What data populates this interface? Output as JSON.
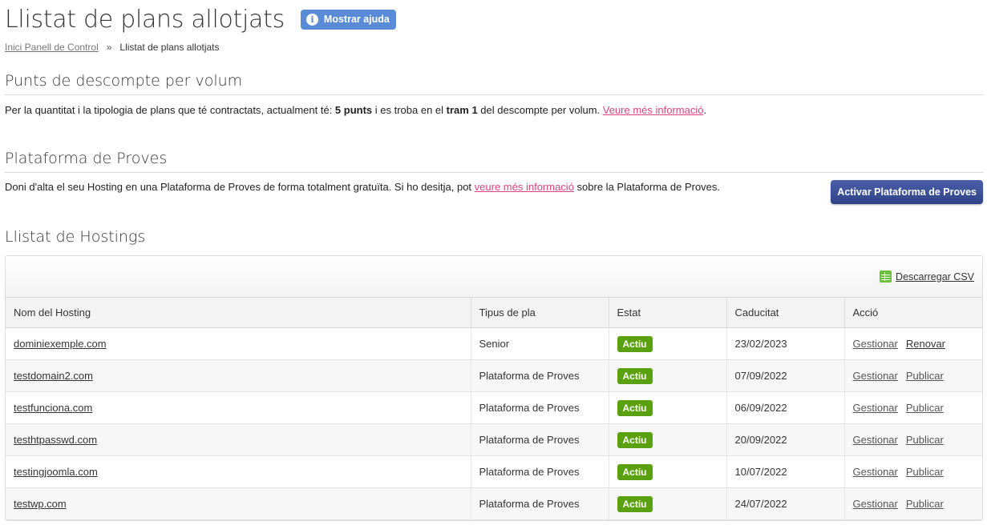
{
  "header": {
    "title": "Llistat de plans allotjats",
    "help_label": "Mostrar ajuda"
  },
  "breadcrumb": {
    "home": "Inici Panell de Control",
    "separator": "»",
    "current": "Llistat de plans allotjats"
  },
  "discount": {
    "title": "Punts de descompte per volum",
    "text_1": "Per la quantitat i la tipologia de plans que té contractats, actualment té: ",
    "points": "5 punts",
    "text_2": " i es troba en el ",
    "tram": "tram 1",
    "text_3": " del descompte per volum. ",
    "link": "Veure més informació",
    "text_4": "."
  },
  "platform": {
    "title": "Plataforma de Proves",
    "text_1": "Doni d'alta el seu Hosting en una Plataforma de Proves de forma totalment gratuïta. Si ho desitja, pot ",
    "link": "veure més informació",
    "text_2": " sobre la Plataforma de Proves.",
    "button": "Activar Plataforma de Proves"
  },
  "hostings": {
    "title": "Llistat de Hostings",
    "csv_label": "Descarregar CSV",
    "columns": [
      "Nom del Hosting",
      "Tipus de pla",
      "Estat",
      "Caducitat",
      "Acció"
    ],
    "rows": [
      {
        "name": "dominiexemple.com",
        "type": "Senior",
        "state": "Actiu",
        "expiry": "23/02/2023",
        "action1": "Gestionar",
        "action2": "Renovar"
      },
      {
        "name": "testdomain2.com",
        "type": "Plataforma de Proves",
        "state": "Actiu",
        "expiry": "07/09/2022",
        "action1": "Gestionar",
        "action2": "Publicar"
      },
      {
        "name": "testfunciona.com",
        "type": "Plataforma de Proves",
        "state": "Actiu",
        "expiry": "06/09/2022",
        "action1": "Gestionar",
        "action2": "Publicar"
      },
      {
        "name": "testhtpasswd.com",
        "type": "Plataforma de Proves",
        "state": "Actiu",
        "expiry": "20/09/2022",
        "action1": "Gestionar",
        "action2": "Publicar"
      },
      {
        "name": "testingjoomla.com",
        "type": "Plataforma de Proves",
        "state": "Actiu",
        "expiry": "10/07/2022",
        "action1": "Gestionar",
        "action2": "Publicar"
      },
      {
        "name": "testwp.com",
        "type": "Plataforma de Proves",
        "state": "Actiu",
        "expiry": "24/07/2022",
        "action1": "Gestionar",
        "action2": "Publicar"
      }
    ]
  },
  "colors": {
    "help_button": "#5a8bd6",
    "link_pink": "#d9447f",
    "primary_button": "#3a4f96",
    "status_active": "#5aa00f",
    "csv_icon": "#6cbf3a"
  }
}
